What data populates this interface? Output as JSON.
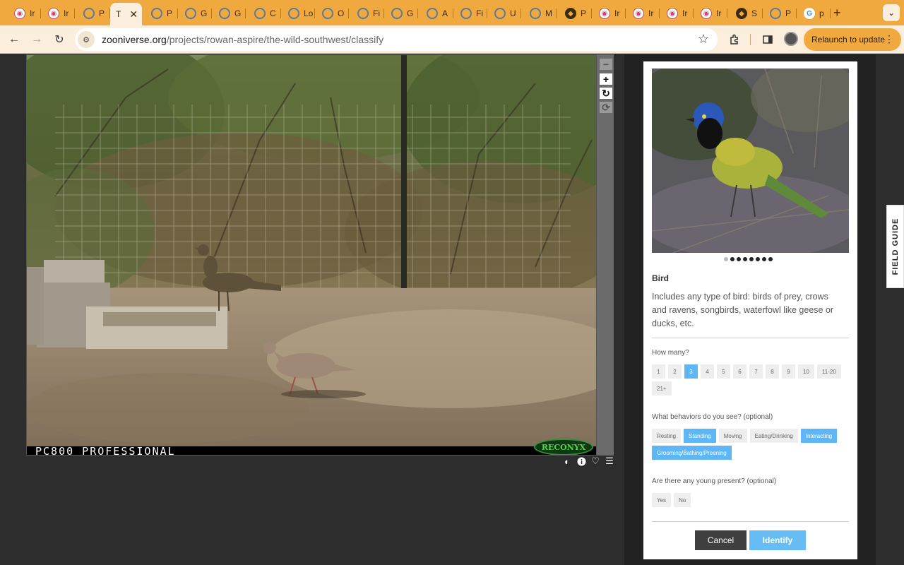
{
  "browser": {
    "tabs": [
      {
        "label": "Ir",
        "icon": "zooniverse-favicon"
      },
      {
        "label": "Ir",
        "icon": "zooniverse-favicon"
      },
      {
        "label": "P",
        "icon": "globe-favicon"
      },
      {
        "label": "T",
        "icon": "",
        "active": true
      },
      {
        "label": "P",
        "icon": "globe-favicon"
      },
      {
        "label": "G",
        "icon": "globe-favicon"
      },
      {
        "label": "G",
        "icon": "globe-favicon"
      },
      {
        "label": "C",
        "icon": "globe-favicon"
      },
      {
        "label": "Lo",
        "icon": "globe-favicon"
      },
      {
        "label": "O",
        "icon": "globe-favicon"
      },
      {
        "label": "Fi",
        "icon": "globe-favicon"
      },
      {
        "label": "G",
        "icon": "globe-favicon"
      },
      {
        "label": "A",
        "icon": "globe-favicon"
      },
      {
        "label": "Fi",
        "icon": "globe-favicon"
      },
      {
        "label": "U",
        "icon": "globe-favicon"
      },
      {
        "label": "M",
        "icon": "globe-favicon"
      },
      {
        "label": "P",
        "icon": "dark-favicon"
      },
      {
        "label": "Ir",
        "icon": "zooniverse-favicon"
      },
      {
        "label": "Ir",
        "icon": "zooniverse-favicon"
      },
      {
        "label": "Ir",
        "icon": "zooniverse-favicon"
      },
      {
        "label": "Ir",
        "icon": "zooniverse-favicon"
      },
      {
        "label": "S",
        "icon": "dark-favicon"
      },
      {
        "label": "P",
        "icon": "globe-favicon"
      },
      {
        "label": "p",
        "icon": "google-favicon"
      }
    ],
    "new_tab": "+",
    "url_host": "zooniverse.org",
    "url_path": "/projects/rowan-aspire/the-wild-southwest/classify",
    "relaunch_label": "Relaunch to update",
    "accent": "#f0a93f"
  },
  "subject": {
    "camera_label": "PC800 PROFESSIONAL",
    "camera_brand": "RECONYX"
  },
  "zoom": {
    "zoom_out": "−",
    "zoom_in": "+",
    "rotate": "↻",
    "reset": "⟳"
  },
  "subject_tools": [
    "contrast-icon",
    "info-icon",
    "heart-icon",
    "list-icon"
  ],
  "panel": {
    "species_name": "Bird",
    "species_description": "Includes any type of bird: birds of prey, crows and ravens, songbirds, waterfowl like geese or ducks, etc.",
    "photo_dots": 8,
    "photo_dots_active": 1,
    "how_many": {
      "question": "How many?",
      "options": [
        "1",
        "2",
        "3",
        "4",
        "5",
        "6",
        "7",
        "8",
        "9",
        "10",
        "11-20",
        "21+"
      ],
      "selected": [
        "3"
      ]
    },
    "behaviors": {
      "question": "What behaviors do you see? (optional)",
      "options": [
        "Resting",
        "Standing",
        "Moving",
        "Eating/Drinking",
        "Interacting",
        "Grooming/Bathing/Preening"
      ],
      "selected": [
        "Standing",
        "Interacting",
        "Grooming/Bathing/Preening"
      ]
    },
    "young": {
      "question": "Are there any young present? (optional)",
      "options": [
        "Yes",
        "No"
      ],
      "selected": []
    },
    "cancel_label": "Cancel",
    "identify_label": "Identify",
    "selected_color": "#5fb6f4"
  },
  "field_guide_label": "FIELD GUIDE"
}
